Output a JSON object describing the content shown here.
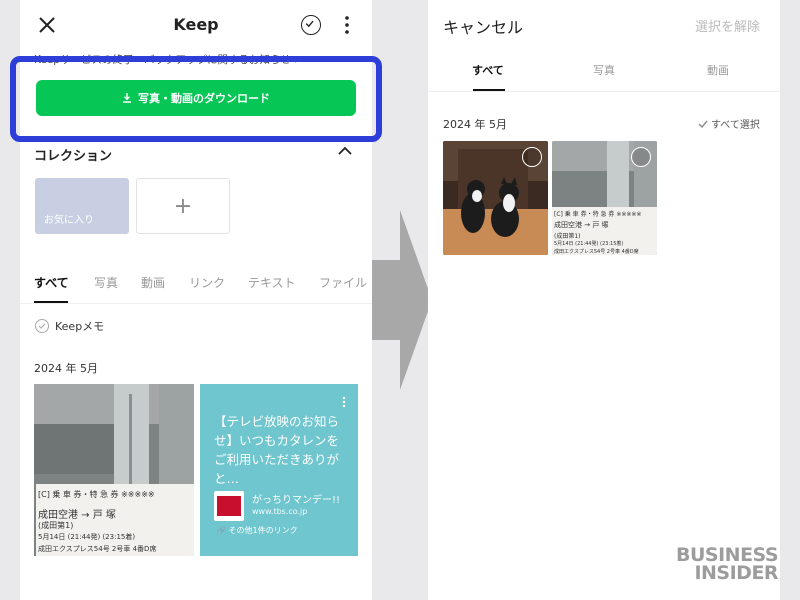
{
  "left": {
    "header_title": "Keep",
    "notice": "Keepサービスの終了・バックアップに関するお知らせ >",
    "download_button": "写真・動画のダウンロード",
    "collection_title": "コレクション",
    "favorites_label": "お気に入り",
    "add_symbol": "+",
    "tabs": [
      "すべて",
      "写真",
      "動画",
      "リンク",
      "テキスト",
      "ファイル"
    ],
    "memo_label": "Keepメモ",
    "date_label": "2024 年 5月",
    "ticket": {
      "line1": "[C] 乗 車 券・特 急 券  ※※※※※",
      "line2": "成田空港  →  戸  塚",
      "line3": "(成田第1)",
      "line4": "5月14日 (21:44発)  (23:15着)",
      "line5": "成田エクスプレス54号  2号車 4番D席"
    },
    "link_card": {
      "text": "【テレビ放映のお知らせ】いつもカタレンをご利用いただきありがと…",
      "site_name": "がっちりマンデー!!",
      "site_url": "www.tbs.co.jp",
      "other_links": "その他1件のリンク"
    }
  },
  "right": {
    "cancel": "キャンセル",
    "deselect": "選択を解除",
    "tabs": [
      "すべて",
      "写真",
      "動画"
    ],
    "date_label": "2024 年 5月",
    "select_all": "すべて選択"
  },
  "watermark": {
    "line1": "BUSINESS",
    "line2": "INSIDER"
  },
  "colors": {
    "download_green": "#06c755",
    "highlight_blue": "#2e3fd9",
    "favorites_card": "#c9cfe3",
    "link_card": "#6fc6ce"
  }
}
